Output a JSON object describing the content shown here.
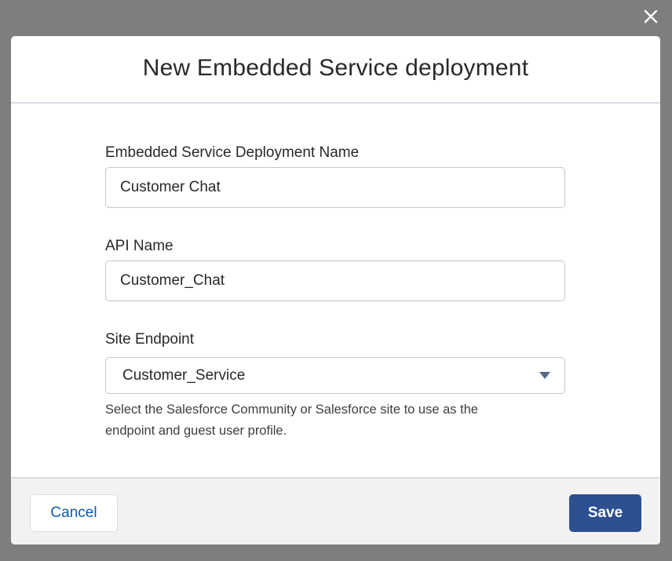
{
  "overlay": {
    "close_icon": "close-icon"
  },
  "modal": {
    "title": "New Embedded Service deployment",
    "fields": {
      "deployment_name": {
        "label": "Embedded Service Deployment Name",
        "value": "Customer Chat"
      },
      "api_name": {
        "label": "API Name",
        "value": "Customer_Chat"
      },
      "site_endpoint": {
        "label": "Site Endpoint",
        "selected": "Customer_Service",
        "arrow_icon": "chevron-down-icon",
        "help_text_line1": "Select the Salesforce Community or Salesforce site to use as the",
        "help_text_line2": "endpoint and guest user profile."
      }
    },
    "footer": {
      "cancel_label": "Cancel",
      "save_label": "Save"
    }
  },
  "colors": {
    "backdrop": "#7e7e7e",
    "save_button": "#2c5090",
    "cancel_text": "#0b5cab",
    "footer_bg": "#f3f2f2"
  }
}
